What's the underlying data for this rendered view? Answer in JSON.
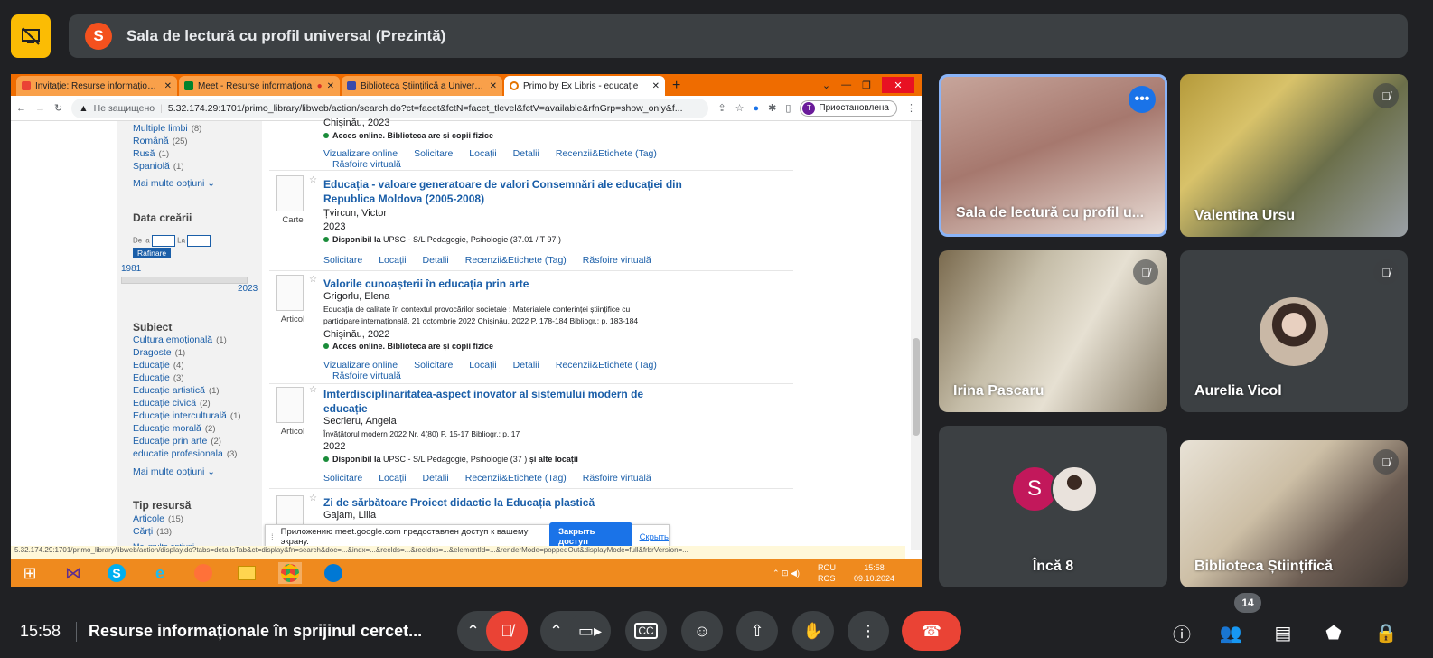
{
  "meeting": {
    "presenter_initial": "S",
    "presenter_title": "Sala de lectură cu profil universal (Prezintă)",
    "clock": "15:58",
    "title": "Resurse informaționale în sprijinul cercet...",
    "participant_count": "14"
  },
  "browser": {
    "tabs": [
      {
        "label": "Invitație: Resurse informaționale"
      },
      {
        "label": "Meet - Resurse informaționa"
      },
      {
        "label": "Biblioteca Științifică a Universităț"
      },
      {
        "label": "Primo by Ex Libris - educație"
      }
    ],
    "not_secure": "Не защищено",
    "url": "5.32.174.29:1701/primo_library/libweb/action/search.do?ct=facet&fctN=facet_tlevel&fctV=available&rfnGrp=show_only&f...",
    "profile_initial": "T",
    "profile_status": "Приостановлена"
  },
  "facets": {
    "languages": [
      {
        "label": "Multiple limbi",
        "count": "(8)"
      },
      {
        "label": "Română",
        "count": "(25)"
      },
      {
        "label": "Rusă",
        "count": "(1)"
      },
      {
        "label": "Spaniolă",
        "count": "(1)"
      }
    ],
    "more": "Mai multe opțiuni",
    "date_heading": "Data creării",
    "date_from": "De la",
    "date_to": "La",
    "refine": "Rafinare",
    "year_min": "1981",
    "year_max": "2023",
    "subject_heading": "Subiect",
    "subjects": [
      {
        "label": "Cultura emoțională",
        "count": "(1)"
      },
      {
        "label": "Dragoste",
        "count": "(1)"
      },
      {
        "label": "Educație",
        "count": "(4)"
      },
      {
        "label": "Educație",
        "count": "(3)"
      },
      {
        "label": "Educație artistică",
        "count": "(1)"
      },
      {
        "label": "Educație civică",
        "count": "(2)"
      },
      {
        "label": "Educație interculturală",
        "count": "(1)"
      },
      {
        "label": "Educație morală",
        "count": "(2)"
      },
      {
        "label": "Educație prin arte",
        "count": "(2)"
      },
      {
        "label": "educatie profesionala",
        "count": "(3)"
      }
    ],
    "resource_heading": "Tip resursă",
    "resources": [
      {
        "label": "Articole",
        "count": "(15)"
      },
      {
        "label": "Cărți",
        "count": "(13)"
      }
    ],
    "more_cut": "Mai multe opțiuni"
  },
  "results": {
    "r0": {
      "place": "Chișinău, 2023",
      "avail": "Acces online. Biblioteca are și copii fizice",
      "l1": "Vizualizare online",
      "l2": "Solicitare",
      "l3": "Locații",
      "l4": "Detalii",
      "l5": "Recenzii&Etichete (Tag)",
      "l6": "Răsfoire virtuală"
    },
    "r1": {
      "type": "Carte",
      "title": "Educația - valoare generatoare de valori Consemnări ale educației din Republica Moldova (2005-2008)",
      "author": "Țvircun, Victor",
      "year": "2023",
      "avail_bold": "Disponibil la",
      "avail": "UPSC - S/L Pedagogie, Psihologie",
      "avail_extra": "(37.01 / T 97 )",
      "l1": "Solicitare",
      "l2": "Locații",
      "l3": "Detalii",
      "l4": "Recenzii&Etichete (Tag)",
      "l5": "Răsfoire virtuală"
    },
    "r2": {
      "type": "Articol",
      "title": "Valorile cunoașterii în educația prin arte",
      "author": "Grigorlu, Elena",
      "src1": "Educația de calitate în contextul provocărilor societale : Materialele conferinței științifice cu",
      "src2": "participare internațională, 21 octombrie 2022 Chișinău, 2022 P. 178-184 Bibliogr.: p. 183-184",
      "place": "Chișinău, 2022",
      "avail": "Acces online. Biblioteca are și copii fizice",
      "l1": "Vizualizare online",
      "l2": "Solicitare",
      "l3": "Locații",
      "l4": "Detalii",
      "l5": "Recenzii&Etichete (Tag)",
      "l6": "Răsfoire virtuală"
    },
    "r3": {
      "type": "Articol",
      "title": "Imterdisciplinaritatea-aspect inovator al sistemului modern de educație",
      "author": "Secrieru, Angela",
      "src": "Învățătorul modern 2022 Nr. 4(80) P. 15-17 Bibliogr.: p. 17",
      "year": "2022",
      "avail_bold": "Disponibil la",
      "avail": "UPSC - S/L Pedagogie, Psihologie",
      "avail_extra": "(37 )",
      "avail_more": "și alte locații",
      "l1": "Solicitare",
      "l2": "Locații",
      "l3": "Detalii",
      "l4": "Recenzii&Etichete (Tag)",
      "l5": "Răsfoire virtuală"
    },
    "r4": {
      "title": "Zi de sărbătoare Proiect didactic la Educația plastică",
      "author": "Gajam, Lilia"
    }
  },
  "status_url": "5.32.174.29:1701/primo_library/libweb/action/display.do?tabs=detailsTab&ct=display&fn=search&doc=...&indx=...&recIds=...&recIdxs=...&elementId=...&renderMode=poppedOut&displayMode=full&frbrVersion=...",
  "share_bar": {
    "message": "Приложению meet.google.com предоставлен доступ к вашему экрану.",
    "stop": "Закрыть доступ",
    "hide": "Скрыть"
  },
  "systray": {
    "lang1": "ROU",
    "lang2": "ROS",
    "time": "15:58",
    "date": "09.10.2024"
  },
  "participants": [
    {
      "name": "Sala de lectură cu profil u..."
    },
    {
      "name": "Valentina Ursu"
    },
    {
      "name": "Irina Pascaru"
    },
    {
      "name": "Aurelia Vicol"
    },
    {
      "name": "Încă 8",
      "initial": "S"
    },
    {
      "name": "Biblioteca Științifică"
    }
  ],
  "colors": {
    "accent": "#1a73e8",
    "leave": "#ea4335",
    "taskbar": "#ef8a1e",
    "tabstrip": "#ef6c00",
    "link": "#1a5ea8"
  }
}
